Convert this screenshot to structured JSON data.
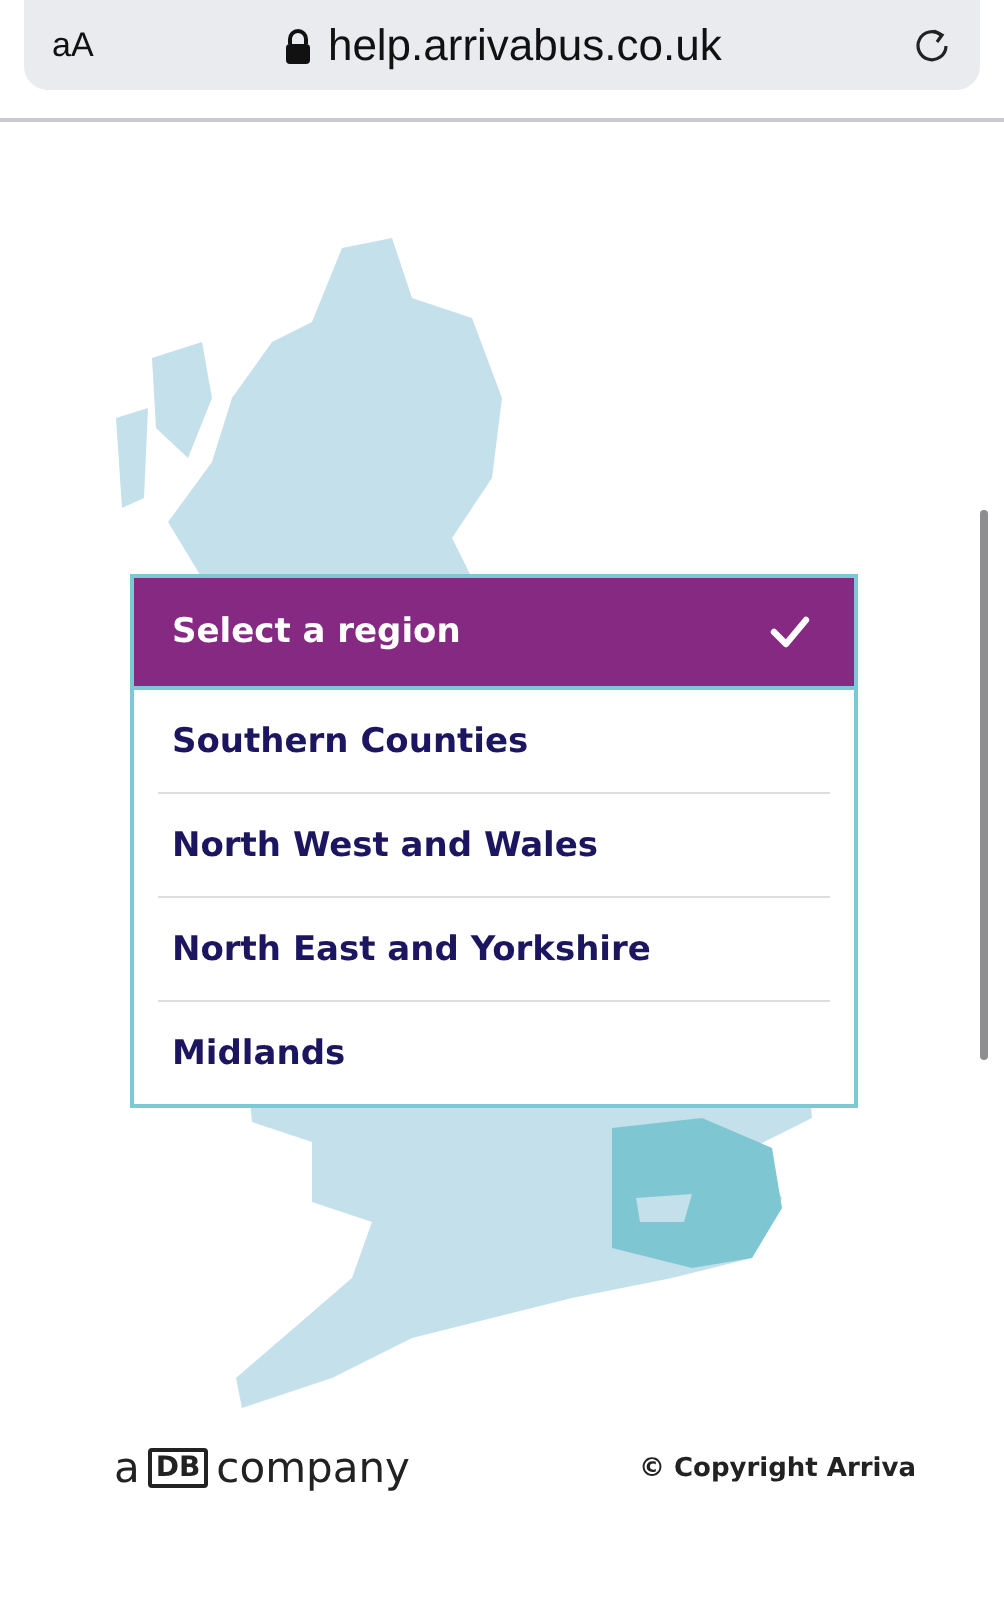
{
  "browser": {
    "text_size_button": "aA",
    "url": "help.arrivabus.co.uk"
  },
  "region_picker": {
    "title": "Select a region",
    "options": [
      {
        "label": "Southern Counties"
      },
      {
        "label": "North West and Wales"
      },
      {
        "label": "North East and Yorkshire"
      },
      {
        "label": "Midlands"
      }
    ]
  },
  "footer": {
    "logo": {
      "prefix": "a",
      "mark": "DB",
      "suffix": "company"
    },
    "copyright": "© Copyright Arriva"
  }
}
